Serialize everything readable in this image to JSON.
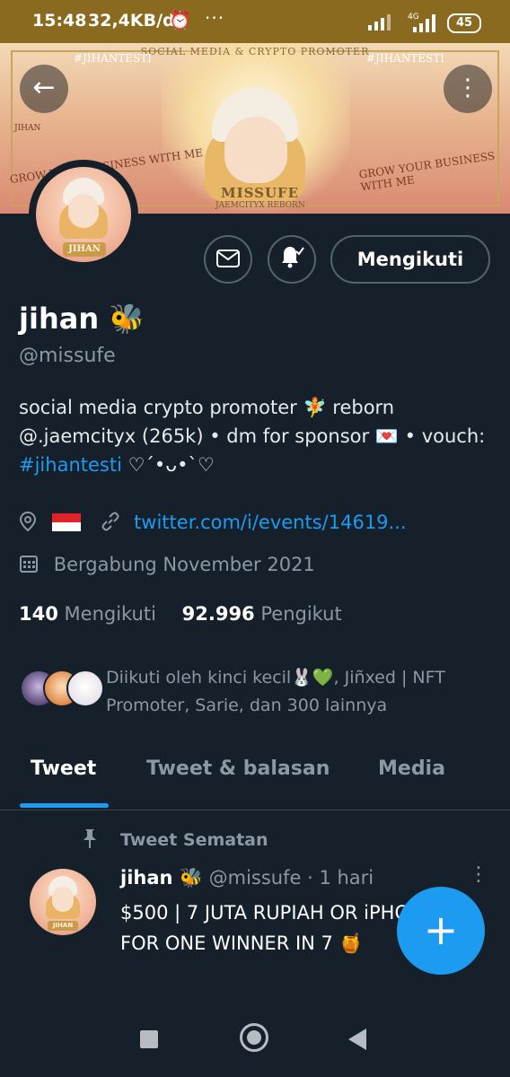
{
  "status_bar": {
    "time": "15:48",
    "speed": "32,4KB/d",
    "alarm_icon": "⏰",
    "dots": "···",
    "signal": "▂▄▆█",
    "network": "4G",
    "battery": "45"
  },
  "banner": {
    "top_text": "SOCIAL MEDIA & CRYPTO PROMOTER",
    "hashtag_left": "#JIHANTESTI",
    "hashtag_right": "#JIHANTESTI",
    "tagline_left": "GROW YOUR BUSINESS WITH ME",
    "tagline_right": "GROW YOUR BUSINESS WITH ME",
    "brand": "MISSUFE",
    "brand_sub": "JAEMCITYX REBORN",
    "side_text": "JIHAN"
  },
  "nav": {
    "back_icon": "arrow-left-icon",
    "back_glyph": "←",
    "more_glyph": "⋮"
  },
  "avatar": {
    "label": "JIHAN"
  },
  "actions": {
    "message_glyph": "✉",
    "notify_glyph": "🔔",
    "follow_label": "Mengikuti"
  },
  "profile": {
    "display_name": "jihan 🐝",
    "handle": "@missufe",
    "bio_text": "social media crypto promoter 🧚 reborn @.jaemcityx (265k) • dm for sponsor 💌 • vouch: ",
    "bio_hashtag": "#jihantesti",
    "bio_suffix": " ♡´•ᴗ•`♡",
    "location_glyph": "⌖",
    "link_glyph": "🔗",
    "link": "twitter.com/i/events/14619...",
    "calendar_glyph": "▦",
    "joined": "Bergabung November 2021",
    "following_count": "140",
    "following_label": "Mengikuti",
    "followers_count": "92.996",
    "followers_label": "Pengikut"
  },
  "followed_by": {
    "text": "Diikuti oleh kinci kecil🐰💚, Jiñxed | NFT Promoter, Sarie, dan 300 lainnya"
  },
  "tabs": [
    {
      "label": "Tweet"
    },
    {
      "label": "Tweet & balasan"
    },
    {
      "label": "Media"
    }
  ],
  "pinned": {
    "glyph": "📌",
    "label": "Tweet Sematan",
    "author": "jihan 🐝",
    "handle_time": "@missufe · 1 hari",
    "more_glyph": "⋮",
    "text": "$500 | 7 JUTA RUPIAH OR iPHONE XR FOR ONE WINNER IN 7 🍯",
    "avatar_label": "JIHAN"
  },
  "fab": {
    "glyph": "+"
  },
  "colors": {
    "background": "#15202b",
    "accent": "#1d9bf0",
    "muted": "#8b98a5",
    "status_bar": "#8a6a1f"
  }
}
